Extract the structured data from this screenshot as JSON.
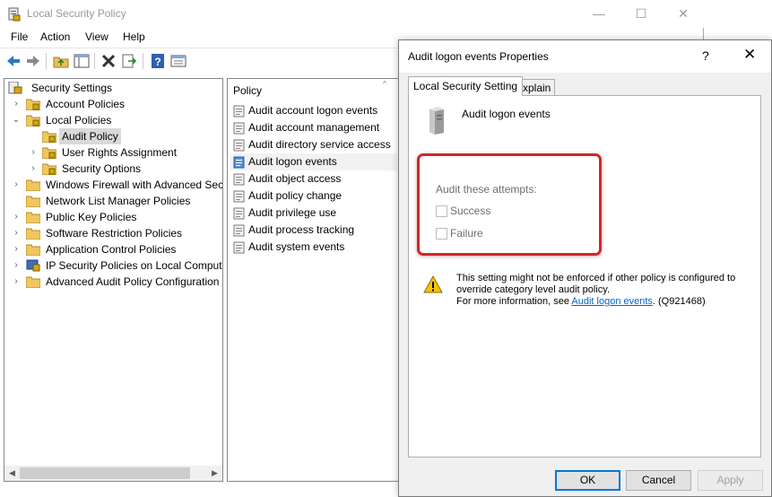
{
  "main_window": {
    "title": "Local Security Policy",
    "controls": {
      "minimize": "—",
      "maximize": "☐",
      "close": "✕"
    }
  },
  "menu": [
    "File",
    "Action",
    "View",
    "Help"
  ],
  "toolbar": {
    "buttons": [
      "back-arrow-icon",
      "forward-arrow-icon",
      "up-folder-icon",
      "show-hide-tree-icon",
      "delete-icon",
      "export-list-icon",
      "help-icon",
      "properties-icon"
    ]
  },
  "tree": {
    "items": [
      {
        "label": "Security Settings",
        "icon": "security-settings-icon",
        "expanded": true
      },
      {
        "label": "Account Policies",
        "icon": "locked-folder-icon"
      },
      {
        "label": "Local Policies",
        "icon": "locked-folder-icon",
        "expanded": true
      },
      {
        "label": "Audit Policy",
        "icon": "locked-folder-icon",
        "selected": true
      },
      {
        "label": "User Rights Assignment",
        "icon": "locked-folder-icon"
      },
      {
        "label": "Security Options",
        "icon": "locked-folder-icon"
      },
      {
        "label": "Windows Firewall with Advanced Secu",
        "icon": "folder-icon"
      },
      {
        "label": "Network List Manager Policies",
        "icon": "folder-icon"
      },
      {
        "label": "Public Key Policies",
        "icon": "folder-icon"
      },
      {
        "label": "Software Restriction Policies",
        "icon": "folder-icon"
      },
      {
        "label": "Application Control Policies",
        "icon": "folder-icon"
      },
      {
        "label": "IP Security Policies on Local Compute",
        "icon": "ip-security-icon"
      },
      {
        "label": "Advanced Audit Policy Configuration",
        "icon": "folder-icon"
      }
    ]
  },
  "policy_list": {
    "header": "Policy",
    "sort_indicator": "^",
    "items": [
      "Audit account logon events",
      "Audit account management",
      "Audit directory service access",
      "Audit logon events",
      "Audit object access",
      "Audit policy change",
      "Audit privilege use",
      "Audit process tracking",
      "Audit system events"
    ],
    "selected": "Audit logon events"
  },
  "dialog": {
    "title": "Audit logon events Properties",
    "help": "?",
    "close": "✕",
    "tabs": [
      "Local Security Setting",
      "Explain"
    ],
    "policy_name": "Audit logon events",
    "audit_label": "Audit these attempts:",
    "checkboxes": [
      {
        "label": "Success",
        "checked": false,
        "enabled": false
      },
      {
        "label": "Failure",
        "checked": false,
        "enabled": false
      }
    ],
    "warning_line1": "This setting might not be enforced if other policy is configured to",
    "warning_line2": "override category level audit policy.",
    "warning_line3_prefix": "For more information, see ",
    "warning_link": "Audit logon events",
    "warning_line3_suffix": ". (Q921468)",
    "buttons": {
      "ok": "OK",
      "cancel": "Cancel",
      "apply": "Apply"
    },
    "highlight_color": "#d02828"
  }
}
